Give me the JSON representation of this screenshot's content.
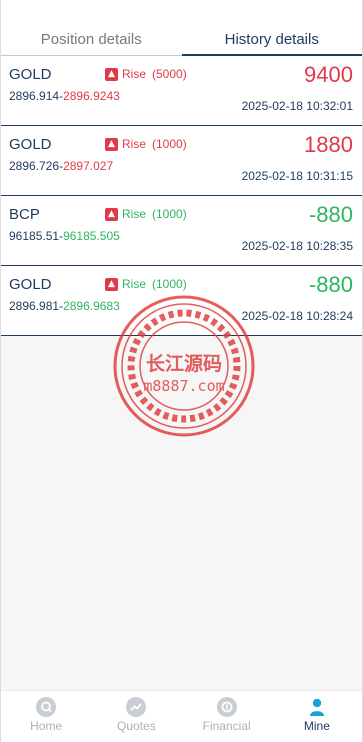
{
  "tabs": [
    {
      "label": "Position details",
      "active": false
    },
    {
      "label": "History details",
      "active": true
    }
  ],
  "orders": [
    {
      "symbol": "GOLD",
      "direction": "Rise",
      "lot": "(5000)",
      "open_price": "2896.914",
      "close_price": "2896.9243",
      "close_color": "red",
      "amount": "9400",
      "amount_color": "red",
      "dir_color": "red",
      "time": "2025-02-18 10:32:01"
    },
    {
      "symbol": "GOLD",
      "direction": "Rise",
      "lot": "(1000)",
      "open_price": "2896.726",
      "close_price": "2897.027",
      "close_color": "red",
      "amount": "1880",
      "amount_color": "red",
      "dir_color": "red",
      "time": "2025-02-18 10:31:15"
    },
    {
      "symbol": "BCP",
      "direction": "Rise",
      "lot": "(1000)",
      "open_price": "96185.51",
      "close_price": "96185.505",
      "close_color": "green",
      "amount": "-880",
      "amount_color": "green",
      "dir_color": "green",
      "time": "2025-02-18 10:28:35"
    },
    {
      "symbol": "GOLD",
      "direction": "Rise",
      "lot": "(1000)",
      "open_price": "2896.981",
      "close_price": "2896.9683",
      "close_color": "green",
      "amount": "-880",
      "amount_color": "green",
      "dir_color": "green",
      "time": "2025-02-18 10:28:24"
    }
  ],
  "watermark": {
    "title": "长江源码",
    "site": "m8887.com",
    "color": "#e03a3a"
  },
  "nav": [
    {
      "label": "Home",
      "icon": "home-icon",
      "active": false
    },
    {
      "label": "Quotes",
      "icon": "quotes-icon",
      "active": false
    },
    {
      "label": "Financial",
      "icon": "financial-icon",
      "active": false
    },
    {
      "label": "Mine",
      "icon": "mine-icon",
      "active": true
    }
  ],
  "colors": {
    "primary": "#1e3a5c",
    "rise": "#e03a4a",
    "fall": "#2fb560"
  }
}
